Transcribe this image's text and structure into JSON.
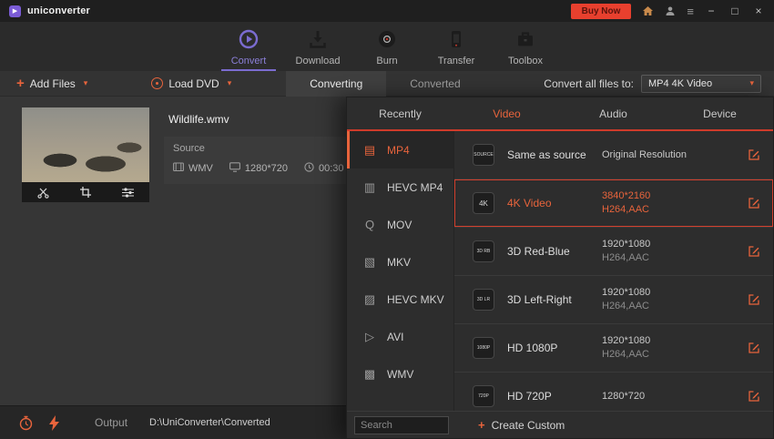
{
  "titlebar": {
    "app_name": "uniconverter",
    "buy_now": "Buy Now"
  },
  "icons": {
    "minimize": "−",
    "maximize": "□",
    "close": "×",
    "menu": "≡",
    "caret": "▾",
    "plus": "+",
    "logo_play": "▶"
  },
  "nav": {
    "tabs": [
      {
        "label": "Convert"
      },
      {
        "label": "Download"
      },
      {
        "label": "Burn"
      },
      {
        "label": "Transfer"
      },
      {
        "label": "Toolbox"
      }
    ]
  },
  "toolbar": {
    "add_files": "Add Files",
    "load_dvd": "Load DVD",
    "converting": "Converting",
    "converted": "Converted",
    "convert_all_label": "Convert all files to:",
    "convert_all_value": "MP4 4K Video"
  },
  "file": {
    "name": "Wildlife.wmv",
    "source_label": "Source",
    "format": "WMV",
    "resolution": "1280*720",
    "duration": "00:30"
  },
  "panel": {
    "tabs": [
      {
        "label": "Recently"
      },
      {
        "label": "Video"
      },
      {
        "label": "Audio"
      },
      {
        "label": "Device"
      }
    ],
    "formats": [
      {
        "label": "MP4",
        "icon": "▤"
      },
      {
        "label": "HEVC MP4",
        "icon": "▥"
      },
      {
        "label": "MOV",
        "icon": "Q"
      },
      {
        "label": "MKV",
        "icon": "▧"
      },
      {
        "label": "HEVC MKV",
        "icon": "▨"
      },
      {
        "label": "AVI",
        "icon": "▷"
      },
      {
        "label": "WMV",
        "icon": "▩"
      }
    ],
    "presets": [
      {
        "badge": "SOURCE",
        "title": "Same as source",
        "res": "Original Resolution",
        "codec": ""
      },
      {
        "badge": "4K",
        "title": "4K Video",
        "res": "3840*2160",
        "codec": "H264,AAC"
      },
      {
        "badge": "3D RB",
        "title": "3D Red-Blue",
        "res": "1920*1080",
        "codec": "H264,AAC"
      },
      {
        "badge": "3D LR",
        "title": "3D Left-Right",
        "res": "1920*1080",
        "codec": "H264,AAC"
      },
      {
        "badge": "1080P",
        "title": "HD 1080P",
        "res": "1920*1080",
        "codec": "H264,AAC"
      },
      {
        "badge": "720P",
        "title": "HD 720P",
        "res": "1280*720",
        "codec": ""
      }
    ],
    "search_placeholder": "Search",
    "create_custom": "Create Custom"
  },
  "statusbar": {
    "output_label": "Output",
    "output_path": "D:\\UniConverter\\Converted"
  }
}
